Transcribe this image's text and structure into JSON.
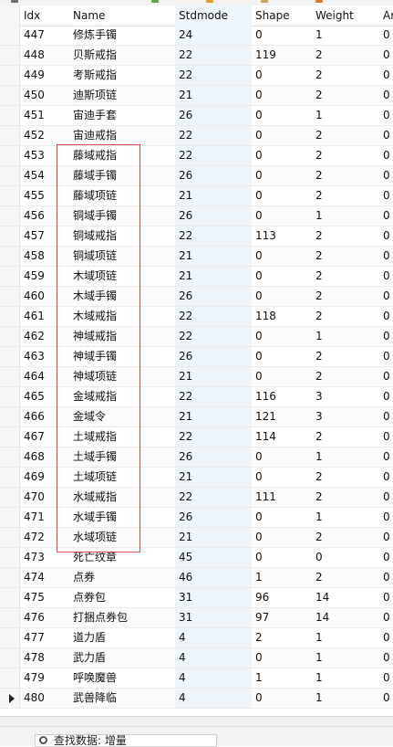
{
  "table": {
    "columns": [
      "Idx",
      "Name",
      "Stdmode",
      "Shape",
      "Weight",
      "Ar"
    ],
    "rows": [
      [
        "447",
        "修炼手镯",
        "24",
        "0",
        "1",
        "0"
      ],
      [
        "448",
        "贝斯戒指",
        "22",
        "119",
        "2",
        "0"
      ],
      [
        "449",
        "考斯戒指",
        "22",
        "0",
        "2",
        "0"
      ],
      [
        "450",
        "迪斯项链",
        "21",
        "0",
        "2",
        "0"
      ],
      [
        "451",
        "宙迪手套",
        "26",
        "0",
        "1",
        "0"
      ],
      [
        "452",
        "宙迪戒指",
        "22",
        "0",
        "2",
        "0"
      ],
      [
        "453",
        "藤域戒指",
        "22",
        "0",
        "2",
        "0"
      ],
      [
        "454",
        "藤域手镯",
        "26",
        "0",
        "2",
        "0"
      ],
      [
        "455",
        "藤域项链",
        "21",
        "0",
        "2",
        "0"
      ],
      [
        "456",
        "铜域手镯",
        "26",
        "0",
        "1",
        "0"
      ],
      [
        "457",
        "铜域戒指",
        "22",
        "113",
        "2",
        "0"
      ],
      [
        "458",
        "铜域项链",
        "21",
        "0",
        "2",
        "0"
      ],
      [
        "459",
        "木域项链",
        "21",
        "0",
        "2",
        "0"
      ],
      [
        "460",
        "木域手镯",
        "26",
        "0",
        "2",
        "0"
      ],
      [
        "461",
        "木域戒指",
        "22",
        "118",
        "2",
        "0"
      ],
      [
        "462",
        "神域戒指",
        "22",
        "0",
        "1",
        "0"
      ],
      [
        "463",
        "神域手镯",
        "26",
        "0",
        "2",
        "0"
      ],
      [
        "464",
        "神域项链",
        "21",
        "0",
        "2",
        "0"
      ],
      [
        "465",
        "金域戒指",
        "22",
        "116",
        "3",
        "0"
      ],
      [
        "466",
        "金域令",
        "21",
        "121",
        "3",
        "0"
      ],
      [
        "467",
        "土域戒指",
        "22",
        "114",
        "2",
        "0"
      ],
      [
        "468",
        "土域手镯",
        "26",
        "0",
        "1",
        "0"
      ],
      [
        "469",
        "土域项链",
        "21",
        "0",
        "2",
        "0"
      ],
      [
        "470",
        "水域戒指",
        "22",
        "111",
        "2",
        "0"
      ],
      [
        "471",
        "水域手镯",
        "26",
        "0",
        "1",
        "0"
      ],
      [
        "472",
        "水域项链",
        "21",
        "0",
        "2",
        "0"
      ],
      [
        "473",
        "死亡纹章",
        "45",
        "0",
        "0",
        "0"
      ],
      [
        "474",
        "点券",
        "46",
        "1",
        "2",
        "0"
      ],
      [
        "475",
        "点券包",
        "31",
        "96",
        "14",
        "0"
      ],
      [
        "476",
        "打捆点券包",
        "31",
        "97",
        "14",
        "0"
      ],
      [
        "477",
        "道力盾",
        "4",
        "2",
        "1",
        "0"
      ],
      [
        "478",
        "武力盾",
        "4",
        "0",
        "1",
        "0"
      ],
      [
        "479",
        "呼唤魔兽",
        "4",
        "1",
        "1",
        "0"
      ],
      [
        "480",
        "武兽降临",
        "4",
        "0",
        "1",
        "0"
      ]
    ],
    "current_row_index": 33,
    "highlight_rows": {
      "from": 6,
      "to": 25,
      "color": "#d94b4b"
    }
  },
  "footer": {
    "search_text": "查找数据: 增量",
    "icon": "search-icon"
  },
  "colors": {
    "stripe": "#eef5fb",
    "grid_line": "#ececec",
    "highlight": "#d94b4b"
  }
}
